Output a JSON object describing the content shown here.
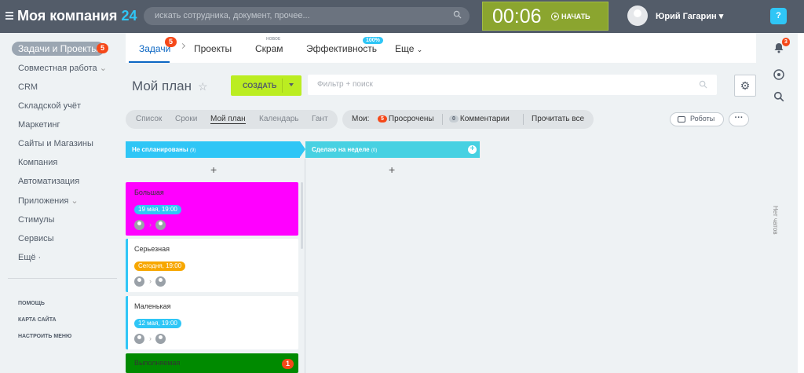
{
  "header": {
    "logo_text": "Моя компания",
    "logo_num": "24",
    "search_placeholder": "искать сотрудника, документ, прочее...",
    "timer": "00:06",
    "start_label": "НАЧАТЬ",
    "user_name": "Юрий Гагарин",
    "help_label": "?"
  },
  "sidebar": {
    "active_label": "Задачи и Проекты",
    "active_badge": "5",
    "items": [
      "Совместная работа",
      "CRM",
      "Складской учёт",
      "Маркетинг",
      "Сайты и Магазины",
      "Компания",
      "Автоматизация",
      "Приложения",
      "Стимулы",
      "Сервисы",
      "Ещё ·"
    ],
    "footer": [
      "ПОМОЩЬ",
      "КАРТА САЙТА",
      "НАСТРОИТЬ МЕНЮ"
    ]
  },
  "tabs": {
    "task": "Задачи",
    "task_badge": "5",
    "projects": "Проекты",
    "scrum": "Скрам",
    "scrum_new": "НОВОЕ",
    "efficiency": "Эффективность",
    "efficiency_pct": "100%",
    "more": "Еще"
  },
  "page": {
    "title": "Мой план",
    "create_label": "СОЗДАТЬ",
    "filter_placeholder": "Фильтр + поиск"
  },
  "views": [
    "Список",
    "Сроки",
    "Мой план",
    "Календарь",
    "Гант"
  ],
  "counters": {
    "my_label": "Мои:",
    "overdue_count": "5",
    "overdue_label": "Просрочены",
    "comments_count": "0",
    "comments_label": "Комментарии",
    "read_all": "Прочитать все"
  },
  "robots_label": "Роботы",
  "columns": [
    {
      "title": "Не спланированы",
      "count": "(9)",
      "color": "#2fc6f6"
    },
    {
      "title": "Сделаю на неделе",
      "count": "(0)",
      "color": "#47d1e2"
    }
  ],
  "cards": [
    {
      "title": "Большая",
      "deadline": "19 мая, 19:00",
      "bg": "#ff00ff",
      "border": "#ff00ff",
      "dl_bg": "#2fc6f6"
    },
    {
      "title": "Серьезная",
      "deadline": "Сегодня, 19:00",
      "bg": "#ffffff",
      "border": "#2fc6f6",
      "dl_bg": "#f7a700"
    },
    {
      "title": "Маленькая",
      "deadline": "12 мая, 19:00",
      "bg": "#ffffff",
      "border": "#2fc6f6",
      "dl_bg": "#2fc6f6"
    },
    {
      "title": "Выполняемая",
      "badge": "1",
      "bg": "#008a00",
      "border": "#008a00"
    }
  ],
  "right_panel": {
    "notif_badge": "3",
    "no_chats": "Нет чатов"
  }
}
